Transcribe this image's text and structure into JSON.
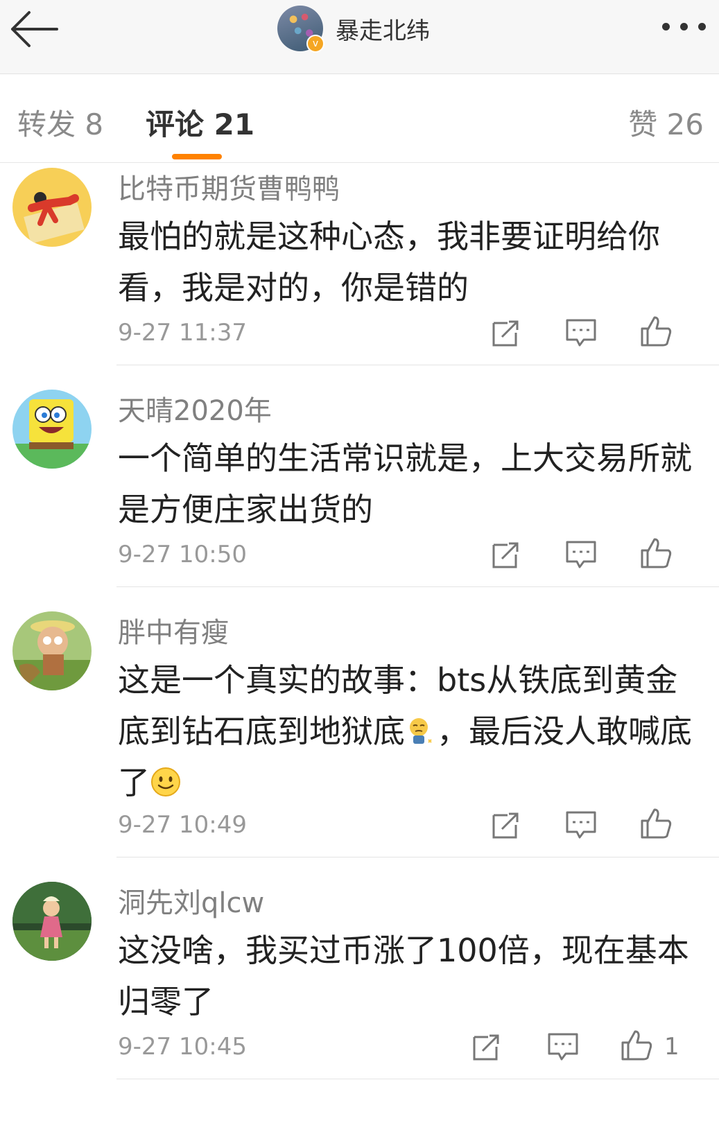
{
  "header": {
    "back_icon": "arrow-left-icon",
    "title": "暴走北纬",
    "more_icon": "more-dots-icon",
    "verified_mark": "v"
  },
  "tabs": [
    {
      "label": "转发 8"
    },
    {
      "label": "评论 21"
    },
    {
      "label": "赞 26"
    }
  ],
  "colors": {
    "accent": "#ff8200",
    "badge": "#f5a623"
  },
  "comments": [
    {
      "user": "比特币期货曹鸭鸭",
      "text": "最怕的就是这种心态，我非要证明给你看，我是对的，你是错的",
      "time": "9-27 11:37",
      "likes": ""
    },
    {
      "user": "天晴2020年",
      "text": "一个简单的生活常识就是，上大交易所就是方便庄家出货的",
      "time": "9-27 10:50",
      "likes": ""
    },
    {
      "user": "胖中有瘦",
      "text_a": "这是一个真实的故事：bts从铁底到黄金底到钻石底到地狱底",
      "text_b": "，最后没人敢喊底了",
      "time": "9-27 10:49",
      "likes": ""
    },
    {
      "user": "洞先刘qlcw",
      "text": "这没啥，我买过币涨了100倍，现在基本归零了",
      "time": "9-27 10:45",
      "likes": "1"
    }
  ]
}
